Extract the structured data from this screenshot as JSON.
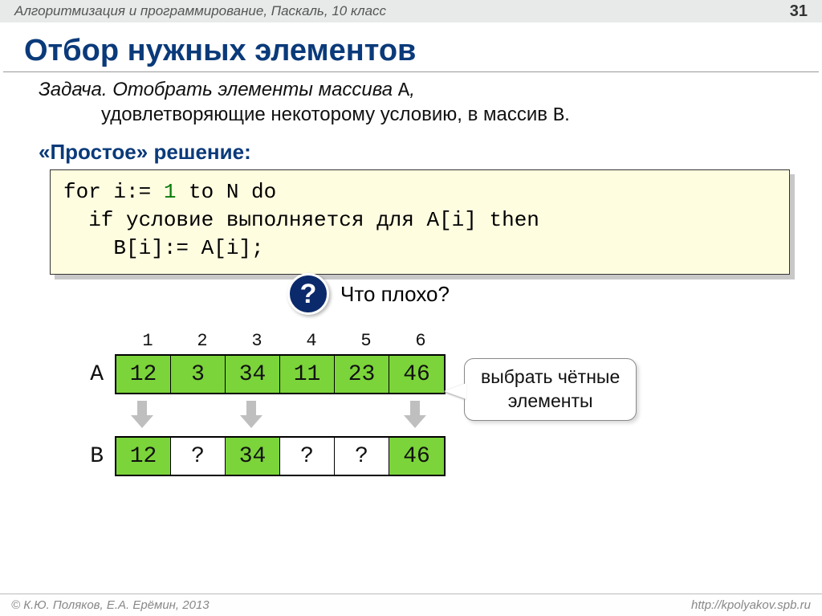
{
  "header": {
    "subject": "Алгоритмизация и программирование, Паскаль, 10 класс",
    "page": "31"
  },
  "title": "Отбор нужных элементов",
  "task": {
    "label": "Задача",
    "line1_part1": ". Отобрать элементы массива ",
    "line1_code": "A",
    "line1_part2": ",",
    "line2_part1": "удовлетворяющие некоторому условию, в массив ",
    "line2_code": "B",
    "line2_part2": "."
  },
  "solution_label": "«Простое» решение:",
  "code": {
    "l1a": "for i:= ",
    "l1_one": "1",
    "l1b": " to N do",
    "l2": "  if условие выполняется для A[i] then",
    "l3": "    B[i]:= A[i];"
  },
  "callout": {
    "mark": "?",
    "text": "Что плохо?"
  },
  "arrays": {
    "indices": [
      "1",
      "2",
      "3",
      "4",
      "5",
      "6"
    ],
    "A_label": "A",
    "A": [
      "12",
      "3",
      "34",
      "11",
      "23",
      "46"
    ],
    "B_label": "B",
    "B": [
      "12",
      "?",
      "34",
      "?",
      "?",
      "46"
    ],
    "B_fill": [
      "green",
      "white",
      "green",
      "white",
      "white",
      "green"
    ],
    "arrows": [
      true,
      false,
      true,
      false,
      false,
      true
    ]
  },
  "select_box": {
    "l1": "выбрать чётные",
    "l2": "элементы"
  },
  "footer": {
    "left": "© К.Ю. Поляков, Е.А. Ерёмин, 2013",
    "right": "http://kpolyakov.spb.ru"
  }
}
